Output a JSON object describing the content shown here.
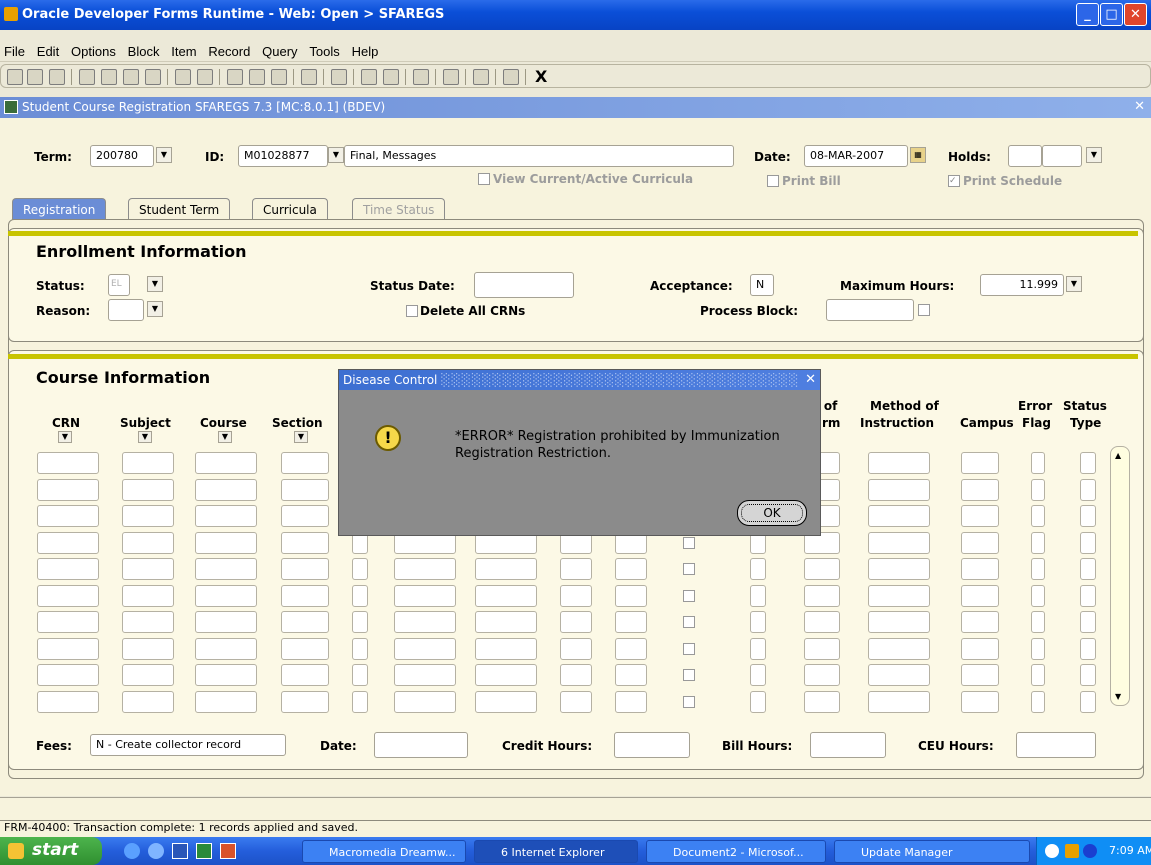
{
  "window": {
    "title": "Oracle Developer Forms Runtime - Web:  Open > SFAREGS"
  },
  "menu": [
    "File",
    "Edit",
    "Options",
    "Block",
    "Item",
    "Record",
    "Query",
    "Tools",
    "Help"
  ],
  "toolbar": {
    "exit_label": "X"
  },
  "form": {
    "title": "Student Course Registration  SFAREGS 7.3  [MC:8.0.1]  (BDEV)",
    "close_glyph": "✕"
  },
  "key_block": {
    "term_label": "Term:",
    "term_value": "200780",
    "id_label": "ID:",
    "id_value": "M01028877",
    "name_value": "Final, Messages",
    "date_label": "Date:",
    "date_value": "08-MAR-2007",
    "holds_label": "Holds:",
    "view_curricula_label": "View Current/Active Curricula",
    "print_bill_label": "Print Bill",
    "print_schedule_label": "Print Schedule"
  },
  "tabs": [
    {
      "label": "Registration",
      "state": "active"
    },
    {
      "label": "Student Term",
      "state": "normal"
    },
    {
      "label": "Curricula",
      "state": "normal"
    },
    {
      "label": "Time Status",
      "state": "disabled"
    }
  ],
  "enrollment": {
    "heading": "Enrollment Information",
    "status_label": "Status:",
    "status_value": "EL",
    "reason_label": "Reason:",
    "status_date_label": "Status Date:",
    "delete_crns_label": "Delete All CRNs",
    "acceptance_label": "Acceptance:",
    "acceptance_value": "N",
    "process_block_label": "Process Block:",
    "max_hours_label": "Maximum Hours:",
    "max_hours_value": "11.999"
  },
  "course": {
    "heading": "Course Information",
    "columns": {
      "crn": "CRN",
      "subject": "Subject",
      "course": "Course",
      "section": "Section",
      "part_of_term_a": "t of",
      "part_of_term_b": "rm",
      "method_a": "Method of",
      "method_b": "Instruction",
      "campus": "Campus",
      "error_a": "Error",
      "error_b": "Flag",
      "status_a": "Status",
      "status_b": "Type"
    },
    "row_count": 10
  },
  "footer": {
    "fees_label": "Fees:",
    "fees_value": "N - Create collector record",
    "date_label": "Date:",
    "credit_hours_label": "Credit Hours:",
    "bill_hours_label": "Bill Hours:",
    "ceu_hours_label": "CEU Hours:"
  },
  "dialog": {
    "title": "Disease Control",
    "message": "*ERROR* Registration prohibited by Immunization Registration Restriction.",
    "ok_label": "OK"
  },
  "status_message": "FRM-40400: Transaction complete: 1 records applied and saved.",
  "taskbar": {
    "start_label": "start",
    "tasks": [
      "Macromedia Dreamw...",
      "6 Internet Explorer",
      "Document2 - Microsof...",
      "Update Manager"
    ],
    "clock": "7:09 AM"
  },
  "colors": {
    "accent": "#0a4fd8",
    "tab_active": "#6b8dd6",
    "section_bar": "#c8c400",
    "dialog_bg": "#8b8b8b"
  }
}
